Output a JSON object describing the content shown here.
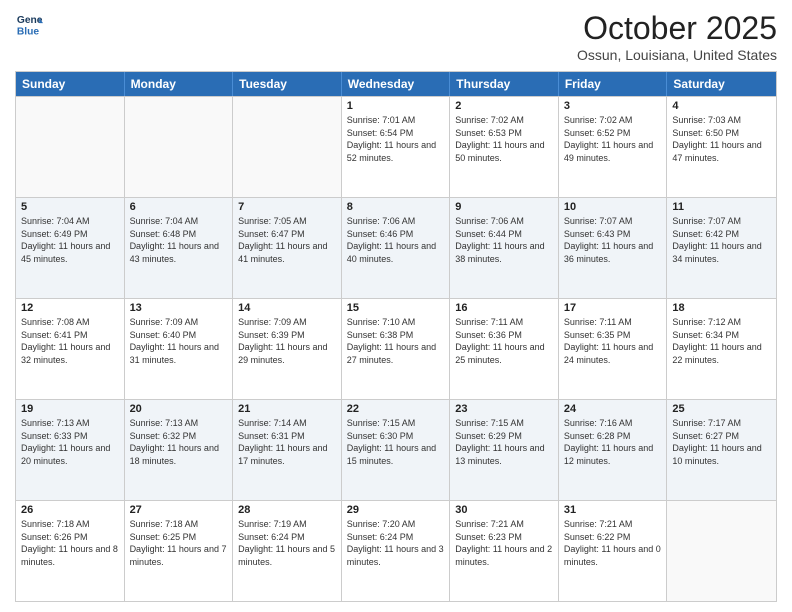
{
  "header": {
    "logo_line1": "General",
    "logo_line2": "Blue",
    "month_title": "October 2025",
    "location": "Ossun, Louisiana, United States"
  },
  "day_headers": [
    "Sunday",
    "Monday",
    "Tuesday",
    "Wednesday",
    "Thursday",
    "Friday",
    "Saturday"
  ],
  "weeks": [
    [
      {
        "day": "",
        "sunrise": "",
        "sunset": "",
        "daylight": ""
      },
      {
        "day": "",
        "sunrise": "",
        "sunset": "",
        "daylight": ""
      },
      {
        "day": "",
        "sunrise": "",
        "sunset": "",
        "daylight": ""
      },
      {
        "day": "1",
        "sunrise": "Sunrise: 7:01 AM",
        "sunset": "Sunset: 6:54 PM",
        "daylight": "Daylight: 11 hours and 52 minutes."
      },
      {
        "day": "2",
        "sunrise": "Sunrise: 7:02 AM",
        "sunset": "Sunset: 6:53 PM",
        "daylight": "Daylight: 11 hours and 50 minutes."
      },
      {
        "day": "3",
        "sunrise": "Sunrise: 7:02 AM",
        "sunset": "Sunset: 6:52 PM",
        "daylight": "Daylight: 11 hours and 49 minutes."
      },
      {
        "day": "4",
        "sunrise": "Sunrise: 7:03 AM",
        "sunset": "Sunset: 6:50 PM",
        "daylight": "Daylight: 11 hours and 47 minutes."
      }
    ],
    [
      {
        "day": "5",
        "sunrise": "Sunrise: 7:04 AM",
        "sunset": "Sunset: 6:49 PM",
        "daylight": "Daylight: 11 hours and 45 minutes."
      },
      {
        "day": "6",
        "sunrise": "Sunrise: 7:04 AM",
        "sunset": "Sunset: 6:48 PM",
        "daylight": "Daylight: 11 hours and 43 minutes."
      },
      {
        "day": "7",
        "sunrise": "Sunrise: 7:05 AM",
        "sunset": "Sunset: 6:47 PM",
        "daylight": "Daylight: 11 hours and 41 minutes."
      },
      {
        "day": "8",
        "sunrise": "Sunrise: 7:06 AM",
        "sunset": "Sunset: 6:46 PM",
        "daylight": "Daylight: 11 hours and 40 minutes."
      },
      {
        "day": "9",
        "sunrise": "Sunrise: 7:06 AM",
        "sunset": "Sunset: 6:44 PM",
        "daylight": "Daylight: 11 hours and 38 minutes."
      },
      {
        "day": "10",
        "sunrise": "Sunrise: 7:07 AM",
        "sunset": "Sunset: 6:43 PM",
        "daylight": "Daylight: 11 hours and 36 minutes."
      },
      {
        "day": "11",
        "sunrise": "Sunrise: 7:07 AM",
        "sunset": "Sunset: 6:42 PM",
        "daylight": "Daylight: 11 hours and 34 minutes."
      }
    ],
    [
      {
        "day": "12",
        "sunrise": "Sunrise: 7:08 AM",
        "sunset": "Sunset: 6:41 PM",
        "daylight": "Daylight: 11 hours and 32 minutes."
      },
      {
        "day": "13",
        "sunrise": "Sunrise: 7:09 AM",
        "sunset": "Sunset: 6:40 PM",
        "daylight": "Daylight: 11 hours and 31 minutes."
      },
      {
        "day": "14",
        "sunrise": "Sunrise: 7:09 AM",
        "sunset": "Sunset: 6:39 PM",
        "daylight": "Daylight: 11 hours and 29 minutes."
      },
      {
        "day": "15",
        "sunrise": "Sunrise: 7:10 AM",
        "sunset": "Sunset: 6:38 PM",
        "daylight": "Daylight: 11 hours and 27 minutes."
      },
      {
        "day": "16",
        "sunrise": "Sunrise: 7:11 AM",
        "sunset": "Sunset: 6:36 PM",
        "daylight": "Daylight: 11 hours and 25 minutes."
      },
      {
        "day": "17",
        "sunrise": "Sunrise: 7:11 AM",
        "sunset": "Sunset: 6:35 PM",
        "daylight": "Daylight: 11 hours and 24 minutes."
      },
      {
        "day": "18",
        "sunrise": "Sunrise: 7:12 AM",
        "sunset": "Sunset: 6:34 PM",
        "daylight": "Daylight: 11 hours and 22 minutes."
      }
    ],
    [
      {
        "day": "19",
        "sunrise": "Sunrise: 7:13 AM",
        "sunset": "Sunset: 6:33 PM",
        "daylight": "Daylight: 11 hours and 20 minutes."
      },
      {
        "day": "20",
        "sunrise": "Sunrise: 7:13 AM",
        "sunset": "Sunset: 6:32 PM",
        "daylight": "Daylight: 11 hours and 18 minutes."
      },
      {
        "day": "21",
        "sunrise": "Sunrise: 7:14 AM",
        "sunset": "Sunset: 6:31 PM",
        "daylight": "Daylight: 11 hours and 17 minutes."
      },
      {
        "day": "22",
        "sunrise": "Sunrise: 7:15 AM",
        "sunset": "Sunset: 6:30 PM",
        "daylight": "Daylight: 11 hours and 15 minutes."
      },
      {
        "day": "23",
        "sunrise": "Sunrise: 7:15 AM",
        "sunset": "Sunset: 6:29 PM",
        "daylight": "Daylight: 11 hours and 13 minutes."
      },
      {
        "day": "24",
        "sunrise": "Sunrise: 7:16 AM",
        "sunset": "Sunset: 6:28 PM",
        "daylight": "Daylight: 11 hours and 12 minutes."
      },
      {
        "day": "25",
        "sunrise": "Sunrise: 7:17 AM",
        "sunset": "Sunset: 6:27 PM",
        "daylight": "Daylight: 11 hours and 10 minutes."
      }
    ],
    [
      {
        "day": "26",
        "sunrise": "Sunrise: 7:18 AM",
        "sunset": "Sunset: 6:26 PM",
        "daylight": "Daylight: 11 hours and 8 minutes."
      },
      {
        "day": "27",
        "sunrise": "Sunrise: 7:18 AM",
        "sunset": "Sunset: 6:25 PM",
        "daylight": "Daylight: 11 hours and 7 minutes."
      },
      {
        "day": "28",
        "sunrise": "Sunrise: 7:19 AM",
        "sunset": "Sunset: 6:24 PM",
        "daylight": "Daylight: 11 hours and 5 minutes."
      },
      {
        "day": "29",
        "sunrise": "Sunrise: 7:20 AM",
        "sunset": "Sunset: 6:24 PM",
        "daylight": "Daylight: 11 hours and 3 minutes."
      },
      {
        "day": "30",
        "sunrise": "Sunrise: 7:21 AM",
        "sunset": "Sunset: 6:23 PM",
        "daylight": "Daylight: 11 hours and 2 minutes."
      },
      {
        "day": "31",
        "sunrise": "Sunrise: 7:21 AM",
        "sunset": "Sunset: 6:22 PM",
        "daylight": "Daylight: 11 hours and 0 minutes."
      },
      {
        "day": "",
        "sunrise": "",
        "sunset": "",
        "daylight": ""
      }
    ]
  ]
}
